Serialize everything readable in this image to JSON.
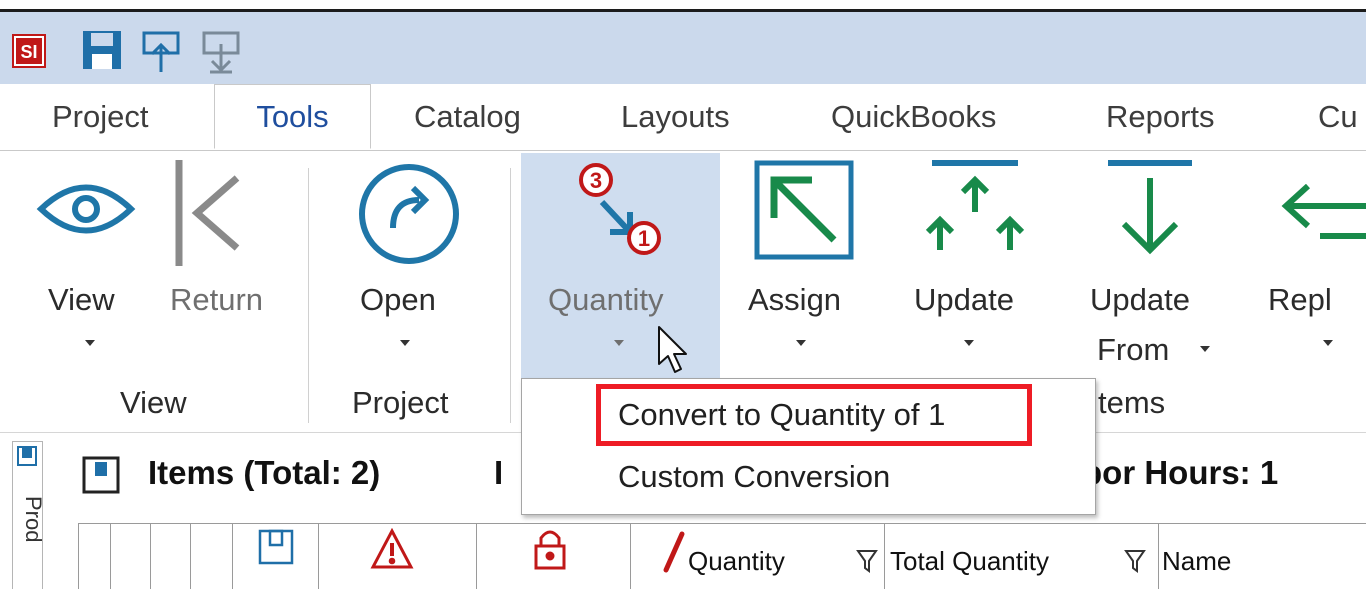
{
  "app": {
    "logo_text": "SI"
  },
  "tabs": [
    {
      "label": "Project"
    },
    {
      "label": "Tools"
    },
    {
      "label": "Catalog"
    },
    {
      "label": "Layouts"
    },
    {
      "label": "QuickBooks"
    },
    {
      "label": "Reports"
    },
    {
      "label": "Cu"
    }
  ],
  "ribbon": {
    "view": "View",
    "return": "Return",
    "open": "Open",
    "quantity": "Quantity",
    "assign": "Assign",
    "update": "Update",
    "update_from_1": "Update",
    "update_from_2": "From",
    "replace": "Repl",
    "groups": {
      "view": "View",
      "project": "Project",
      "items": "tems"
    }
  },
  "menu": {
    "convert": "Convert to Quantity of 1",
    "custom": "Custom Conversion"
  },
  "panel": {
    "side_tab": "Prod",
    "items_title": "Items (Total: 2)",
    "title_fragment": "I",
    "labor_fragment": "bor Hours: 1",
    "columns": {
      "quantity": "Quantity",
      "total_quantity": "Total Quantity",
      "name": "Name"
    }
  },
  "colors": {
    "accent_blue": "#1f4e9e",
    "teal": "#1f76a8",
    "green": "#188a4a",
    "highlight": "#ee1c25",
    "ribbon_hover": "#cfddef"
  }
}
